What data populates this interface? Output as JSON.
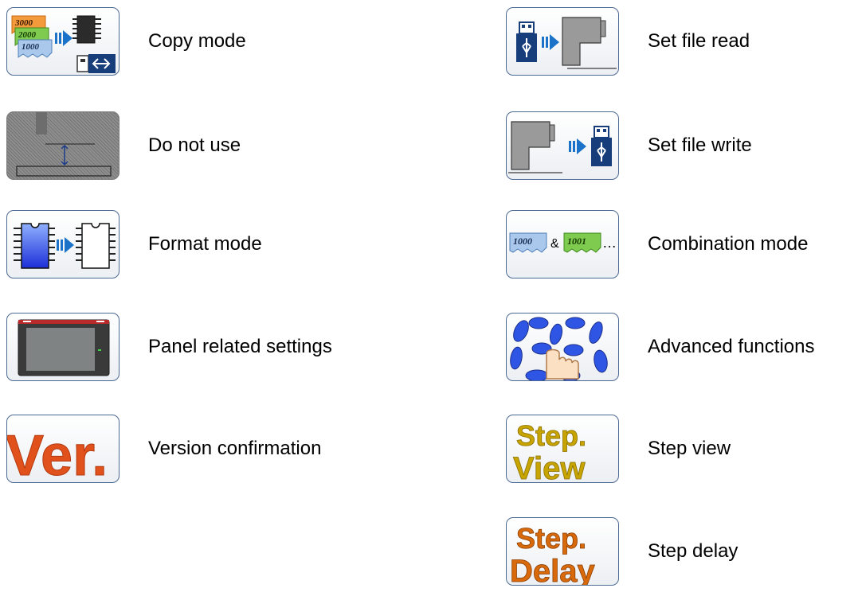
{
  "left_column": [
    {
      "label": "Copy mode",
      "icon": "copy-mode-icon",
      "tags": [
        "3000",
        "2000",
        "1000"
      ]
    },
    {
      "label": "Do not use",
      "icon": "do-not-use-icon"
    },
    {
      "label": "Format mode",
      "icon": "format-mode-icon"
    },
    {
      "label": "Panel related settings",
      "icon": "panel-icon"
    },
    {
      "label": "Version confirmation",
      "icon": "version-icon",
      "icon_text": "Ver."
    }
  ],
  "right_column": [
    {
      "label": "Set file read",
      "icon": "usb-to-machine-icon"
    },
    {
      "label": "Set file write",
      "icon": "machine-to-usb-icon"
    },
    {
      "label": "Combination mode",
      "icon": "combination-icon",
      "tags": [
        "1000",
        "1001"
      ],
      "amp": "&",
      "ellipsis": "…"
    },
    {
      "label": "Advanced functions",
      "icon": "advanced-functions-icon"
    },
    {
      "label": "Step view",
      "icon": "step-view-icon",
      "icon_text_1": "Step.",
      "icon_text_2": "View"
    },
    {
      "label": "Step delay",
      "icon": "step-delay-icon",
      "icon_text_1": "Step.",
      "icon_text_2": "Delay"
    }
  ],
  "colors": {
    "border": "#4d6a93",
    "arrow": "#1a73c8",
    "usb": "#173d7a",
    "ver": "#e0511c",
    "step_view": "#c8a400",
    "step_delay": "#d96a0c"
  }
}
